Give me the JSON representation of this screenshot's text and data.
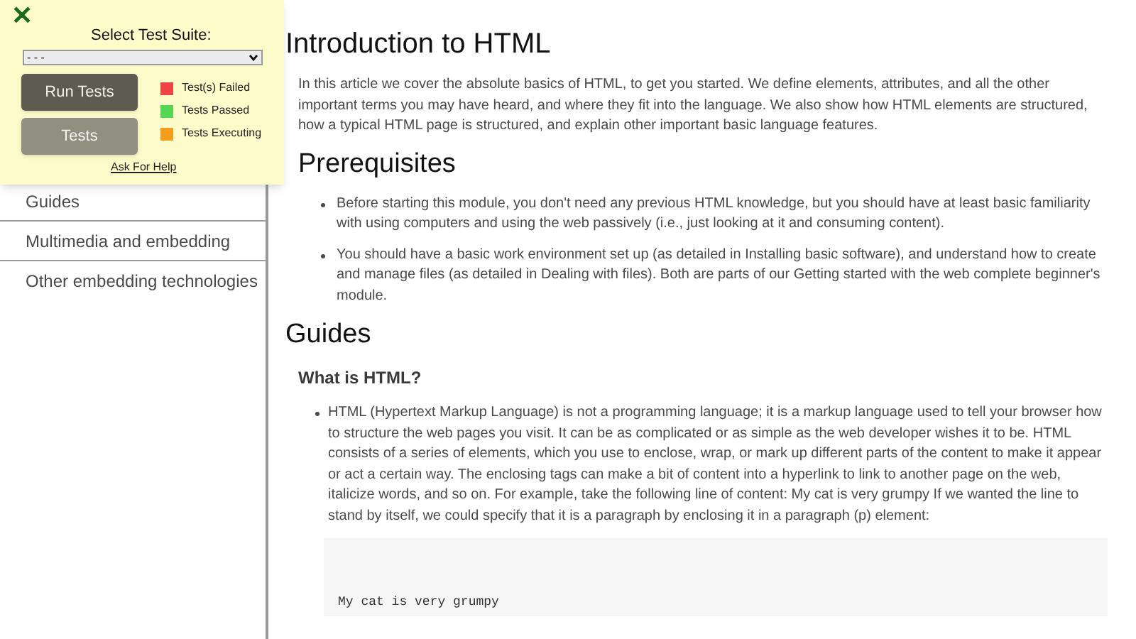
{
  "test_panel": {
    "close": "✕",
    "label": "Select Test Suite:",
    "select_value": "- - -",
    "buttons": [
      {
        "label": "Run Tests",
        "kind": "primary"
      },
      {
        "label": "Tests",
        "kind": "secondary"
      }
    ],
    "legend": [
      {
        "label": "Test(s) Failed",
        "color": "#ef4444"
      },
      {
        "label": "Tests Passed",
        "color": "#55d655"
      },
      {
        "label": "Tests Executing",
        "color": "#f59e1b"
      }
    ],
    "help_link": "Ask For Help"
  },
  "sidebar": {
    "items": [
      "Guides",
      "Multimedia and embedding",
      "Other embedding technologies"
    ]
  },
  "article": {
    "title": "Introduction to HTML",
    "intro": "In this article we cover the absolute basics of HTML, to get you started. We define elements, attributes, and all the other important terms you may have heard, and where they fit into the language. We also show how HTML elements are structured, how a typical HTML page is structured, and explain other important basic language features.",
    "prerequisites": {
      "heading": "Prerequisites",
      "items": [
        "Before starting this module, you don't need any previous HTML knowledge, but you should have at least basic familiarity with using computers and using the web passively (i.e., just looking at it and consuming content).",
        "You should have a basic work environment set up (as detailed in Installing basic software), and understand how to create and manage files (as detailed in Dealing with files). Both are parts of our Getting started with the web complete beginner's module."
      ]
    },
    "guides": {
      "heading": "Guides",
      "subheading": "What is HTML?",
      "items": [
        "HTML (Hypertext Markup Language) is not a programming language; it is a markup language used to tell your browser how to structure the web pages you visit. It can be as complicated or as simple as the web developer wishes it to be. HTML consists of a series of elements, which you use to enclose, wrap, or mark up different parts of the content to make it appear or act a certain way. The enclosing tags can make a bit of content into a hyperlink to link to another page on the web, italicize words, and so on. For example, take the following line of content: My cat is very grumpy If we wanted the line to stand by itself, we could specify that it is a paragraph by enclosing it in a paragraph (p) element:"
      ],
      "code": "My cat is very grumpy"
    }
  }
}
